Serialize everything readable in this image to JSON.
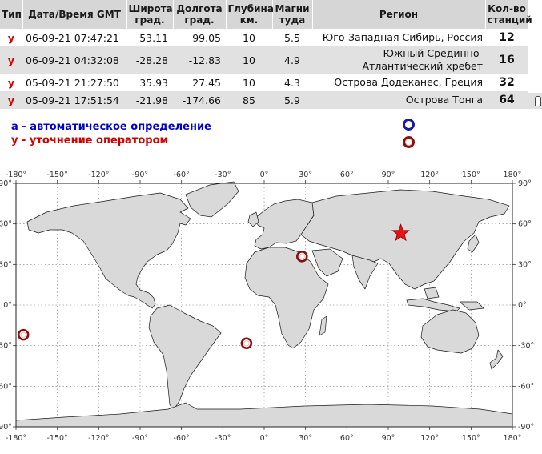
{
  "table": {
    "headers": {
      "type": "Тип",
      "datetime": "Дата/Время GMT",
      "lat": "Широта\nград.",
      "lon": "Долгота\nград.",
      "depth": "Глубина\nкм.",
      "mag": "Магни\nтуда",
      "region": "Регион",
      "stations": "Кол-во\nстанций"
    },
    "rows": [
      {
        "type": "у",
        "datetime": "06-09-21 07:47:21",
        "lat": "53.11",
        "lon": "99.05",
        "depth": "10",
        "mag": "5.5",
        "region": "Юго-Западная Сибирь, Россия",
        "stations": "12"
      },
      {
        "type": "у",
        "datetime": "06-09-21 04:32:08",
        "lat": "-28.28",
        "lon": "-12.83",
        "depth": "10",
        "mag": "4.9",
        "region": "Южный Срединно-\nАтлантический хребет",
        "stations": "16"
      },
      {
        "type": "у",
        "datetime": "05-09-21 21:27:50",
        "lat": "35.93",
        "lon": "27.45",
        "depth": "10",
        "mag": "4.3",
        "region": "Острова Додеканес, Греция",
        "stations": "32"
      },
      {
        "type": "у",
        "datetime": "05-09-21 17:51:54",
        "lat": "-21.98",
        "lon": "-174.66",
        "depth": "85",
        "mag": "5.9",
        "region": "Острова Тонга",
        "stations": "64"
      }
    ]
  },
  "legend": {
    "auto": "а - автоматическое определение",
    "operator": "у - уточнение оператором"
  },
  "map": {
    "lon_ticks": [
      "-180°",
      "-150°",
      "-120°",
      "-90°",
      "-60°",
      "-30°",
      "0°",
      "30°",
      "60°",
      "90°",
      "120°",
      "150°",
      "180°"
    ],
    "lat_ticks_left": [
      "90°",
      "60°",
      "30°",
      "0°",
      "-30°",
      "-60°",
      "-90°"
    ],
    "lat_ticks_right": [
      "90°",
      "60°",
      "30°",
      "0°",
      "-30°",
      "-60°",
      "-90°"
    ],
    "lon_values": [
      -180,
      -150,
      -120,
      -90,
      -60,
      -30,
      0,
      30,
      60,
      90,
      120,
      150,
      180
    ],
    "lat_values": [
      90,
      60,
      30,
      0,
      -30,
      -60,
      -90
    ],
    "events": [
      {
        "lat": 53.11,
        "lon": 99.05,
        "symbol": "star"
      },
      {
        "lat": -28.28,
        "lon": -12.83,
        "symbol": "circle"
      },
      {
        "lat": 35.93,
        "lon": 27.45,
        "symbol": "circle"
      },
      {
        "lat": -21.98,
        "lon": -174.66,
        "symbol": "circle"
      }
    ],
    "colors": {
      "land": "#d9d9d9",
      "coast": "#1a1a1a",
      "ocean": "#ffffff",
      "event_circle": "#8a1010",
      "event_star": "#ee1111"
    }
  }
}
